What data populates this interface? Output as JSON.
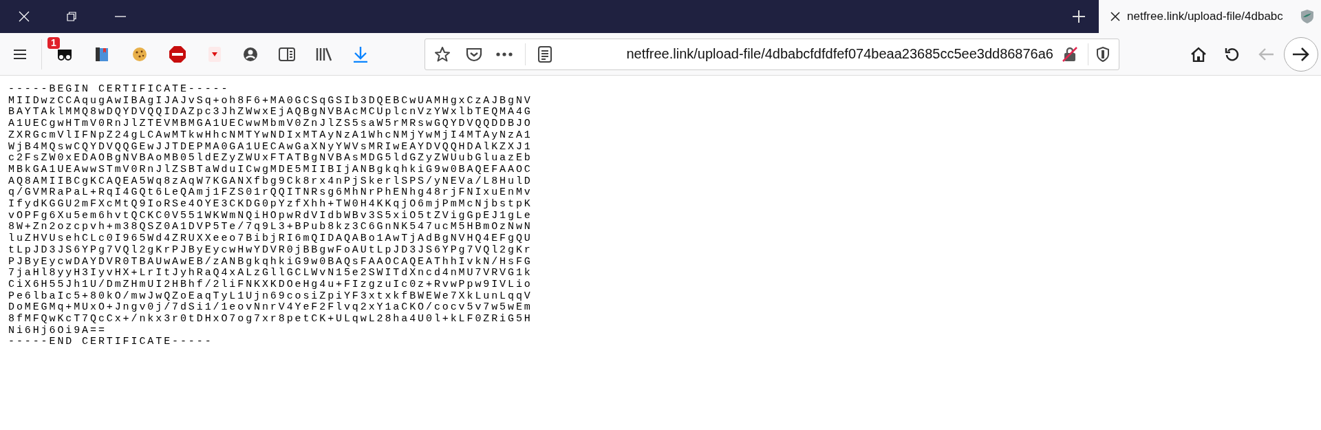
{
  "tabs": [
    {
      "title": "netfree.link/upload-file/4dbabc",
      "selected": true
    }
  ],
  "toolbar": {
    "badge": "1"
  },
  "address_bar": {
    "url": "netfree.link/upload-file/4dbabcfdfdfef074beaa23685cc5ee3dd86876a6"
  },
  "navigation": {
    "back_disabled": true,
    "forward_disabled": false
  },
  "content": {
    "lines": [
      "-----BEGIN CERTIFICATE-----",
      "MIIDwzCCAqugAwIBAgIJAJvSq+oh8F6+MA0GCSqGSIb3DQEBCwUAMHgxCzAJBgNV",
      "BAYTAklMMQ8wDQYDVQQIDAZpc3JhZWwxEjAQBgNVBAcMCUplcnVzYWxlbTEQMA4G",
      "A1UECgwHTmV0RnJlZTEVMBMGA1UECwwMbmV0ZnJlZS5saW5rMRswGQYDVQQDDBJO",
      "ZXRGcmVlIFNpZ24gLCAwMTkwHhcNMTYwNDIxMTAyNzA1WhcNMjYwMjI4MTAyNzA1",
      "WjB4MQswCQYDVQQGEwJJTDEPMA0GA1UECAwGaXNyYWVsMRIwEAYDVQQHDAlKZXJ1",
      "c2FsZW0xEDAOBgNVBAoMB05ldEZyZWUxFTATBgNVBAsMDG5ldGZyZWUubGluazEb",
      "MBkGA1UEAwwSTmV0RnJlZSBTaWduICwgMDE5MIIBIjANBgkqhkiG9w0BAQEFAAOC",
      "AQ8AMIIBCgKCAQEA5Wq8zAqW7KGANXfbg9Ck8rx4nPjSkerlSPS/yNEVa/L8HulD",
      "q/GVMRaPaL+RqI4GQt6LeQAmj1FZS01rQQITNRsg6MhNrPhENhg48rjFNIxuEnMv",
      "IfydKGGU2mFXcMtQ9IoRSe4OYE3CKDG0pYzfXhh+TW0H4KKqjO6mjPmMcNjbstpK",
      "vOPFg6Xu5em6hvtQCKC0V551WKWmNQiHOpwRdVIdbWBv3S5xiO5tZVigGpEJ1gLe",
      "8W+Zn2ozcpvh+m38QSZ0A1DVP5Te/7q9L3+BPub8kz3C6GnNK547ucM5HBmOzNwN",
      "luZHVUsehCLc0I965Wd4ZRUXXeeo7BibjRI6mQIDAQABo1AwTjAdBgNVHQ4EFgQU",
      "tLpJD3JS6YPg7VQl2gKrPJByEycwHwYDVR0jBBgwFoAUtLpJD3JS6YPg7VQl2gKr",
      "PJByEycwDAYDVR0TBAUwAwEB/zANBgkqhkiG9w0BAQsFAAOCAQEAThhIvkN/HsFG",
      "7jaHl8yyH3IyvHX+LrItJyhRaQ4xALzGllGCLWvN15e2SWITdXncd4nMU7VRVG1k",
      "CiX6H55Jh1U/DmZHmUI2HBhf/2liFNKXKDOeHg4u+FIzgzuIc0z+RvwPpw9IVLio",
      "Pe6lbaIc5+80kO/mwJwQZoEaqTyL1Ujn69cosiZpiYF3xtxkfBWEWe7XkLunLqqV",
      "DoMEGMq+MUxO+Jngv0j/7dSi1/1eovNnrV4YeF2Flvq2xY1aCKO/cocv5v7w5wEm",
      "8fMFQwKcT7QcCx+/nkx3r0tDHxO7og7xr8petCK+ULqwL28ha4U0l+kLF0ZRiG5H",
      "Ni6Hj6Oi9A==",
      "-----END CERTIFICATE-----"
    ]
  }
}
